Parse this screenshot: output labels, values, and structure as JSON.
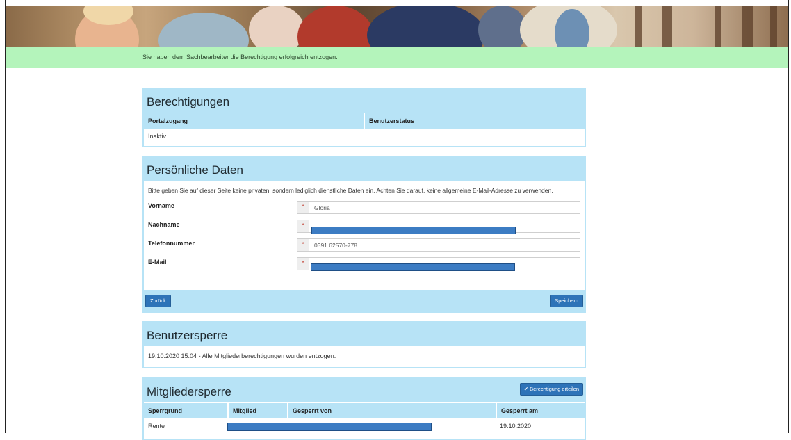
{
  "notice": {
    "message": "Sie haben dem Sachbearbeiter die Berechtigung erfolgreich entzogen."
  },
  "berechtigungen": {
    "title": "Berechtigungen",
    "columns": [
      "Portalzugang",
      "Benutzerstatus"
    ],
    "rows": [
      [
        "Inaktiv",
        ""
      ]
    ]
  },
  "persoenliche_daten": {
    "title": "Persönliche Daten",
    "info": "Bitte geben Sie auf dieser Seite keine privaten, sondern lediglich dienstliche Daten ein. Achten Sie darauf, keine allgemeine E-Mail-Adresse zu verwenden.",
    "fields": [
      {
        "label": "Vorname",
        "value": "Gloria",
        "required_mark": "*"
      },
      {
        "label": "Nachname",
        "value": "",
        "required_mark": "*",
        "redacted": true
      },
      {
        "label": "Telefonnummer",
        "value": "0391 62570-778",
        "required_mark": "*"
      },
      {
        "label": "E-Mail",
        "value": "",
        "required_mark": "*",
        "redacted": true
      }
    ],
    "back_label": "Zurück",
    "save_label": "Speichern"
  },
  "benutzersperre": {
    "title": "Benutzersperre",
    "entry": "19.10.2020 15:04 - Alle Mitgliederberechtigungen wurden entzogen."
  },
  "mitgliedersperre": {
    "title": "Mitgliedersperre",
    "grant_label": "Berechtigung erteilen",
    "grant_icon": "check-icon",
    "columns": [
      "Sperrgrund",
      "Mitglied",
      "Gesperrt von",
      "Gesperrt am"
    ],
    "rows": [
      {
        "sperrgrund": "Rente",
        "mitglied": "",
        "gesperrt_von": "",
        "gesperrt_am": "19.10.2020",
        "redacted": true
      }
    ]
  },
  "colors": {
    "panel_accent": "#b7e3f6",
    "notice_bg": "#b4f4bb",
    "button": "#2d73b8",
    "redaction": "#3c7cc3"
  }
}
